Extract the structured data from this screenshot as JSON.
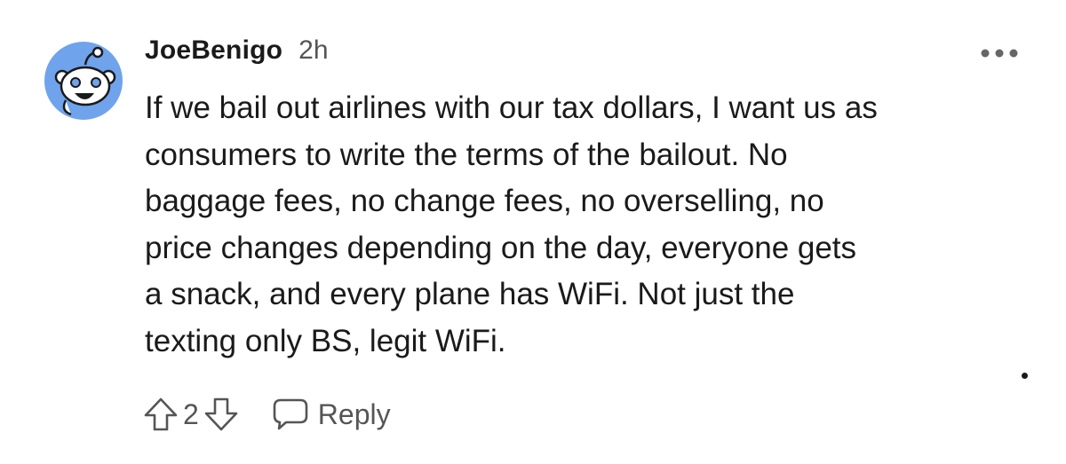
{
  "comment": {
    "author": "JoeBenigo",
    "time": "2h",
    "body_lines": [
      "If we bail out airlines with our tax dollars, I want us as",
      "consumers to write the terms of the bailout. No",
      "baggage fees, no change fees, no overselling, no",
      "price changes depending on the day, everyone gets",
      "a snack, and every plane has WiFi. Not just the",
      "texting only BS, legit WiFi."
    ],
    "score": "2",
    "reply_label": "Reply"
  },
  "icons": {
    "avatar": "reddit-snoo-avatar",
    "more": "more-horizontal-icon",
    "upvote": "upvote-arrow-icon",
    "downvote": "downvote-arrow-icon",
    "reply": "speech-bubble-icon"
  },
  "colors": {
    "avatar_bg": "#6fa3ec",
    "text": "#1a1a1b",
    "muted": "#555555"
  }
}
